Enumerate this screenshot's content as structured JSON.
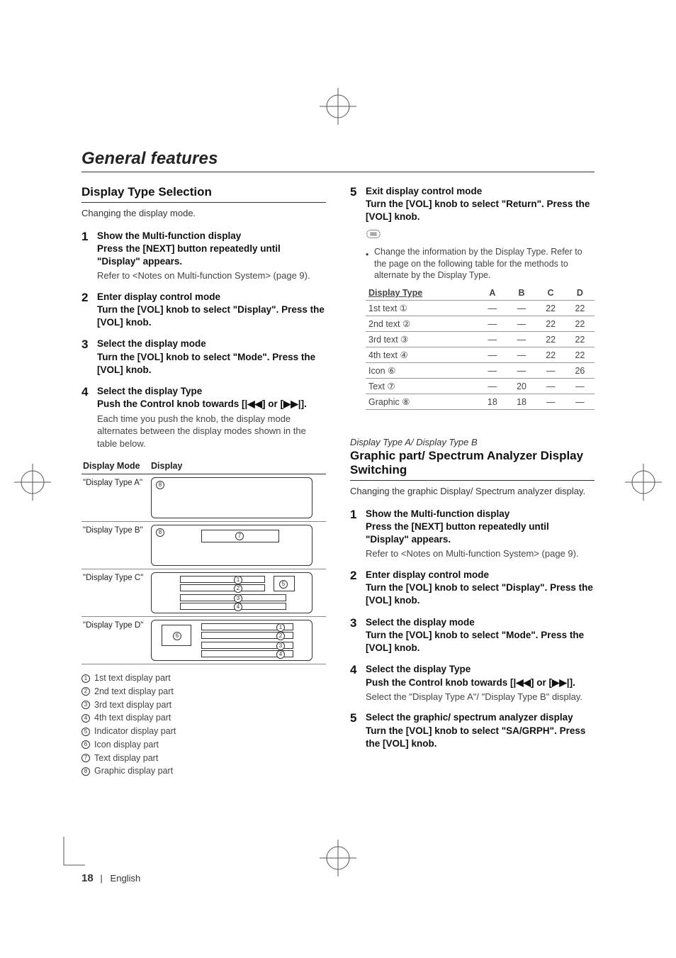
{
  "section_title": "General features",
  "left": {
    "heading": "Display Type Selection",
    "lead": "Changing the display mode.",
    "steps": [
      {
        "num": "1",
        "head": "Show the Multi-function display",
        "sub": "Press the [NEXT] button repeatedly until \"Display\" appears.",
        "note": "Refer to <Notes on Multi-function System> (page 9)."
      },
      {
        "num": "2",
        "head": "Enter display control mode",
        "sub": "Turn the [VOL] knob to select \"Display\". Press the [VOL] knob."
      },
      {
        "num": "3",
        "head": "Select the display mode",
        "sub": "Turn the [VOL] knob to select \"Mode\". Press the [VOL] knob."
      },
      {
        "num": "4",
        "head": "Select the display Type",
        "sub": "Push the Control knob towards [|◀◀] or [▶▶|].",
        "note": "Each time you push the knob, the display mode alternates between the display modes shown in the table below."
      }
    ],
    "mode_table": {
      "headers": [
        "Display Mode",
        "Display"
      ],
      "rows": [
        {
          "mode": "\"Display Type A\"",
          "parts": [
            "8"
          ]
        },
        {
          "mode": "\"Display Type B\"",
          "parts": [
            "8",
            "7"
          ]
        },
        {
          "mode": "\"Display Type C\"",
          "parts": [
            "1",
            "2",
            "3",
            "4",
            "5"
          ]
        },
        {
          "mode": "\"Display Type D\"",
          "parts": [
            "6",
            "1",
            "2",
            "3",
            "4"
          ]
        }
      ]
    },
    "legend": [
      {
        "n": "1",
        "t": "1st text display part"
      },
      {
        "n": "2",
        "t": "2nd text display part"
      },
      {
        "n": "3",
        "t": "3rd text display part"
      },
      {
        "n": "4",
        "t": "4th text display part"
      },
      {
        "n": "5",
        "t": "Indicator display part"
      },
      {
        "n": "6",
        "t": "Icon display part"
      },
      {
        "n": "7",
        "t": "Text display part"
      },
      {
        "n": "8",
        "t": "Graphic display part"
      }
    ]
  },
  "right": {
    "step5": {
      "num": "5",
      "head": "Exit display control mode",
      "sub": "Turn the [VOL] knob to select \"Return\". Press the [VOL] knob."
    },
    "note_bullet": "Change the information by the Display Type. Refer to the page on the following table for the methods to alternate by the Display Type.",
    "data_table": {
      "headers": [
        "Display Type",
        "A",
        "B",
        "C",
        "D"
      ],
      "rows": [
        {
          "label": "1st text ①",
          "vals": [
            "—",
            "—",
            "22",
            "22"
          ]
        },
        {
          "label": "2nd text ②",
          "vals": [
            "—",
            "—",
            "22",
            "22"
          ]
        },
        {
          "label": "3rd text ③",
          "vals": [
            "—",
            "—",
            "22",
            "22"
          ]
        },
        {
          "label": "4th text ④",
          "vals": [
            "—",
            "—",
            "22",
            "22"
          ]
        },
        {
          "label": "Icon ⑥",
          "vals": [
            "—",
            "—",
            "—",
            "26"
          ]
        },
        {
          "label": "Text ⑦",
          "vals": [
            "—",
            "20",
            "—",
            "—"
          ]
        },
        {
          "label": "Graphic ⑧",
          "vals": [
            "18",
            "18",
            "—",
            "—"
          ]
        }
      ]
    },
    "sub_italic": "Display Type A/ Display Type B",
    "heading2": "Graphic part/ Spectrum Analyzer Display Switching",
    "lead2": "Changing the graphic Display/ Spectrum analyzer display.",
    "steps2": [
      {
        "num": "1",
        "head": "Show the Multi-function display",
        "sub": "Press the [NEXT] button repeatedly until \"Display\" appears.",
        "note": "Refer to <Notes on Multi-function System> (page 9)."
      },
      {
        "num": "2",
        "head": "Enter display control mode",
        "sub": "Turn the [VOL] knob to select \"Display\". Press the [VOL] knob."
      },
      {
        "num": "3",
        "head": "Select the display mode",
        "sub": "Turn the [VOL] knob to select \"Mode\". Press the [VOL] knob."
      },
      {
        "num": "4",
        "head": "Select the display Type",
        "sub": "Push the Control knob towards [|◀◀] or [▶▶|].",
        "note": "Select the \"Display Type A\"/ \"Display Type B\" display."
      },
      {
        "num": "5",
        "head": "Select the graphic/ spectrum analyzer display",
        "sub": "Turn the [VOL] knob to select \"SA/GRPH\". Press the [VOL] knob."
      }
    ]
  },
  "footer": {
    "page": "18",
    "sep": "|",
    "lang": "English"
  }
}
